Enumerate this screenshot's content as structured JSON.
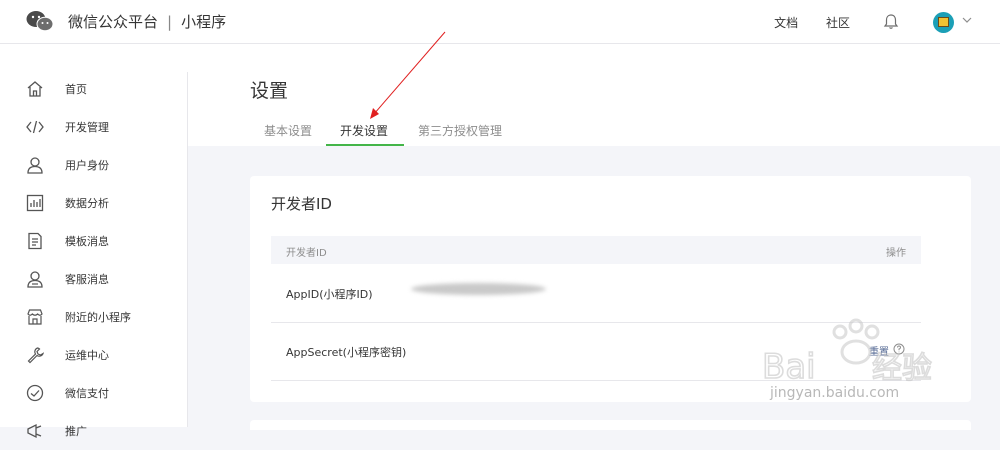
{
  "header": {
    "brand_name": "微信公众平台",
    "separator": "|",
    "product_name": "小程序",
    "links": [
      "文档",
      "社区"
    ],
    "icons": [
      "wechat-logo",
      "bell-icon",
      "avatar",
      "chevron-down-icon"
    ]
  },
  "sidebar": {
    "items": [
      {
        "label": "首页",
        "icon": "home-icon"
      },
      {
        "label": "开发管理",
        "icon": "code-icon"
      },
      {
        "label": "用户身份",
        "icon": "user-icon"
      },
      {
        "label": "数据分析",
        "icon": "chart-icon"
      },
      {
        "label": "模板消息",
        "icon": "document-icon"
      },
      {
        "label": "客服消息",
        "icon": "support-icon"
      },
      {
        "label": "附近的小程序",
        "icon": "store-icon"
      },
      {
        "label": "运维中心",
        "icon": "wrench-icon"
      },
      {
        "label": "微信支付",
        "icon": "pay-icon"
      },
      {
        "label": "推广",
        "icon": "promote-icon"
      }
    ]
  },
  "main": {
    "title": "设置",
    "tabs": [
      {
        "label": "基本设置",
        "active": false
      },
      {
        "label": "开发设置",
        "active": true
      },
      {
        "label": "第三方授权管理",
        "active": false
      }
    ],
    "card": {
      "title": "开发者ID",
      "columns": [
        "开发者ID",
        "操作"
      ],
      "rows": [
        {
          "key": "AppID(小程序ID)",
          "value": "",
          "action": ""
        },
        {
          "key": "AppSecret(小程序密钥)",
          "value": "",
          "action": "重置"
        }
      ]
    }
  },
  "watermark": {
    "text": "jingyan.baidu.com"
  },
  "colors": {
    "accent": "#44b549",
    "link": "#576b95",
    "annotation": "#e02020"
  }
}
